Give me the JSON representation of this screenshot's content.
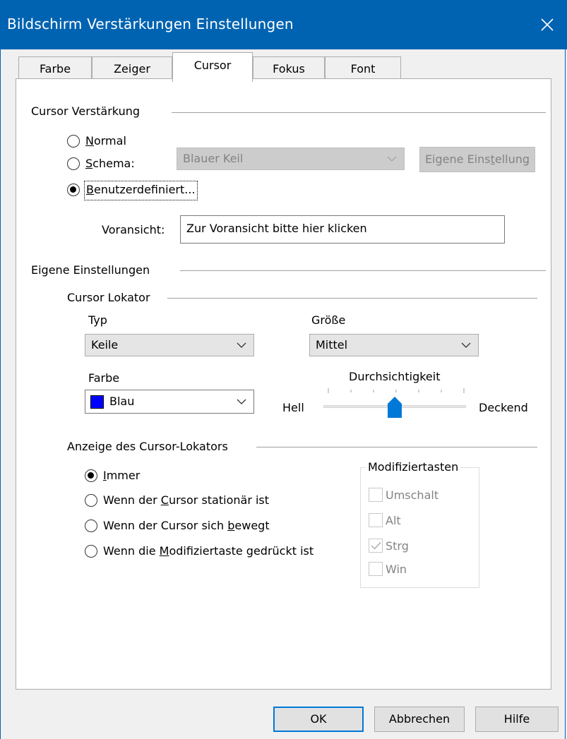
{
  "window": {
    "title": "Bildschirm Verstärkungen Einstellungen",
    "close_icon": "close-icon"
  },
  "tabs": [
    {
      "label": "Farbe",
      "active": false
    },
    {
      "label": "Zeiger",
      "active": false
    },
    {
      "label": "Cursor",
      "active": true
    },
    {
      "label": "Fokus",
      "active": false
    },
    {
      "label": "Font",
      "active": false
    }
  ],
  "cursor_section": {
    "heading": "Cursor Verstärkung",
    "options": {
      "normal": {
        "accel": "N",
        "rest": "ormal"
      },
      "schema": {
        "accel": "S",
        "rest": "chema:"
      },
      "custom": {
        "accel": "B",
        "rest": "enutzerdefiniert..."
      }
    },
    "selected": "custom",
    "schema_select": "Blauer Keil",
    "own_setting_button": {
      "pre": "Eigene Eins",
      "accel": "t",
      "post": "ellung"
    },
    "preview_label": "Voransicht:",
    "preview_value": "Zur Voransicht bitte hier klicken"
  },
  "own_settings": {
    "heading": "Eigene Einstellungen",
    "locator_heading": "Cursor Lokator",
    "type_label": "Typ",
    "type_value": "Keile",
    "size_label": "Größe",
    "size_value": "Mittel",
    "color_label": "Farbe",
    "color_value": "Blau",
    "color_swatch": "#0000ff",
    "transparency_label": "Durchsichtigkeit",
    "slider_min_label": "Hell",
    "slider_max_label": "Deckend",
    "slider_level": 0.5
  },
  "display_section": {
    "heading": "Anzeige des Cursor-Lokators",
    "options": {
      "always": {
        "pre": "",
        "accel": "I",
        "post": "mmer"
      },
      "stationary": {
        "pre": "Wenn der ",
        "accel": "C",
        "post": "ursor stationär ist"
      },
      "moving": {
        "pre": "Wenn der Cursor sich ",
        "accel": "b",
        "post": "ewegt"
      },
      "modifier": {
        "pre": "Wenn die ",
        "accel": "M",
        "post": "odifiziertaste gedrückt ist"
      }
    },
    "selected": "always"
  },
  "modifier_keys": {
    "heading": "Modifiziertasten",
    "items": [
      {
        "label": "Umschalt",
        "checked": false
      },
      {
        "label": "Alt",
        "checked": false
      },
      {
        "label": "Strg",
        "checked": true
      },
      {
        "label": "Win",
        "checked": false
      }
    ]
  },
  "buttons": {
    "ok": "OK",
    "cancel": "Abbrechen",
    "help": "Hilfe"
  },
  "colors": {
    "accent": "#0063b1",
    "slider_thumb": "#0078d7"
  }
}
